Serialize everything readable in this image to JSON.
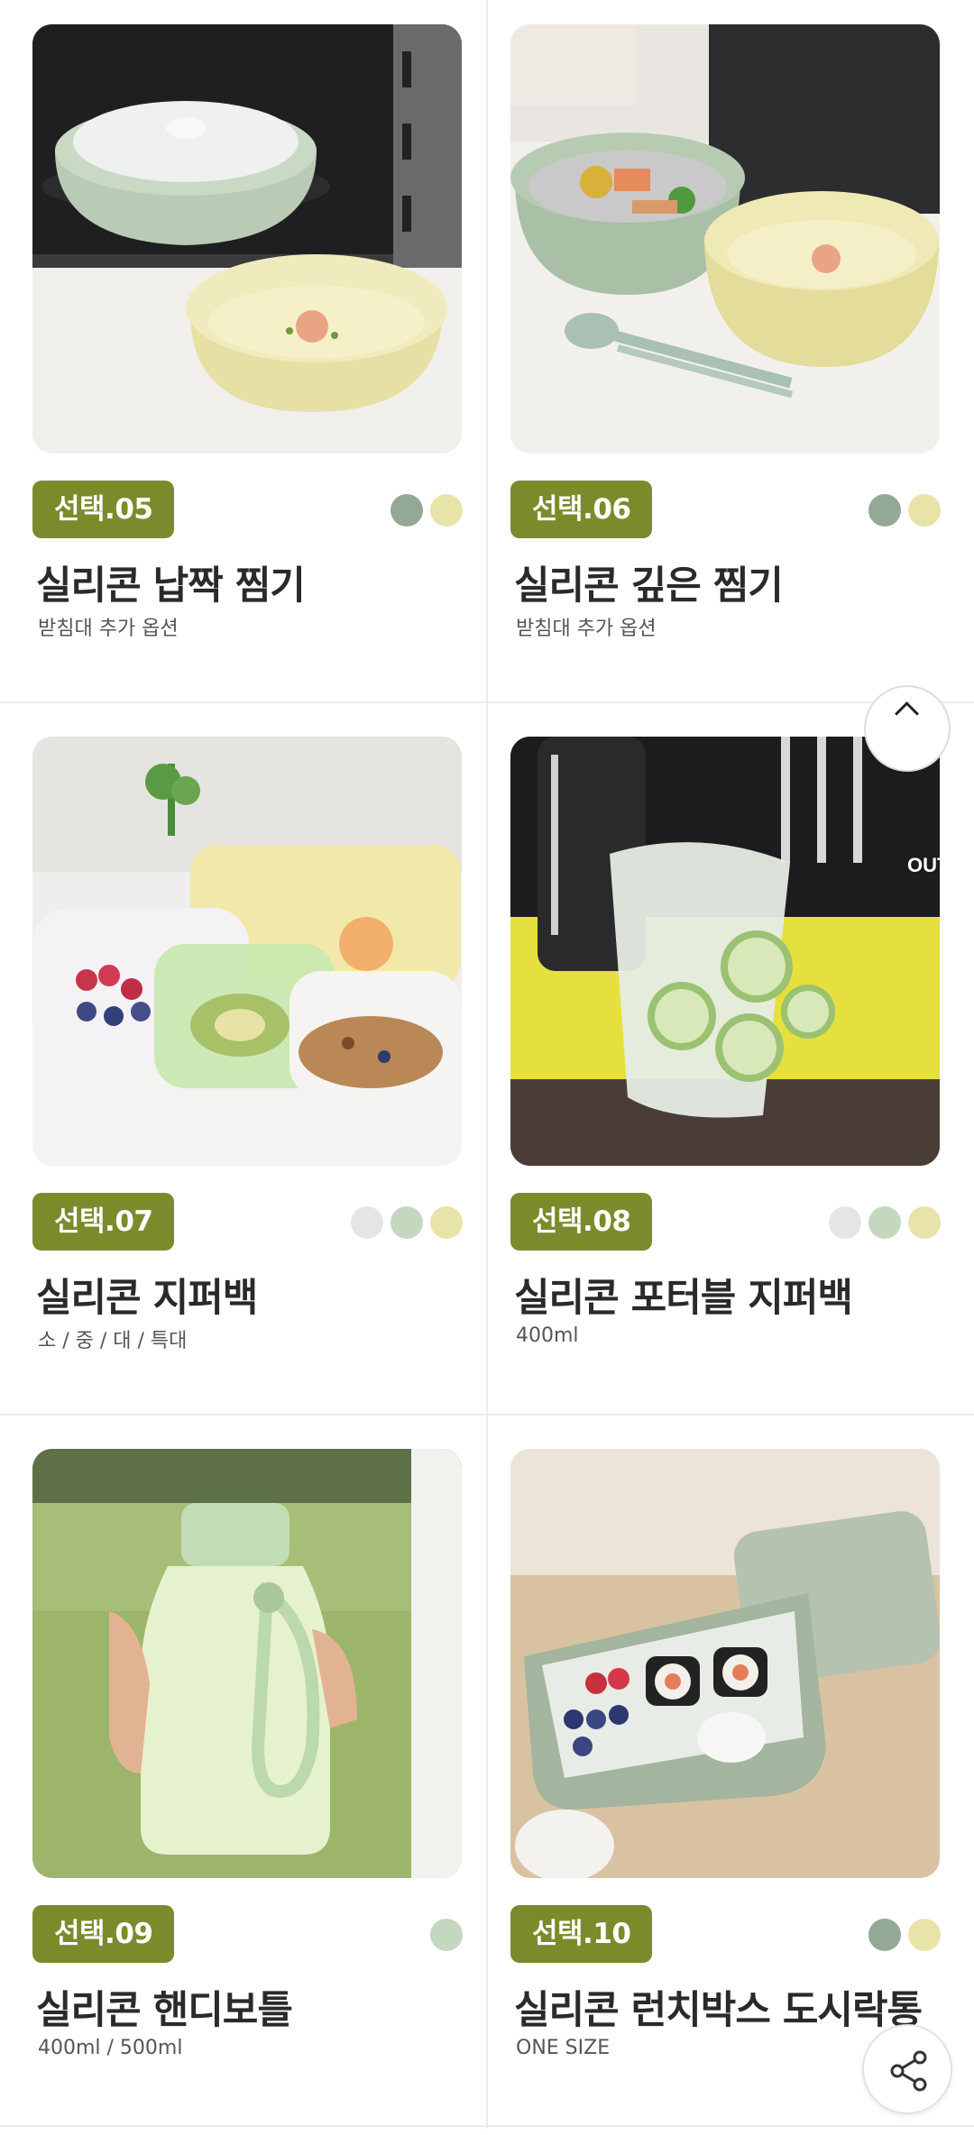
{
  "products": [
    {
      "tag": "선택.05",
      "title": "실리콘 납짝 찜기",
      "sub": "받침대 추가 옵션",
      "swatches": [
        "#94a896",
        "#e8e3a8"
      ],
      "image": "microwave-steamer-photo"
    },
    {
      "tag": "선택.06",
      "title": "실리콘 깊은 찜기",
      "sub": "받침대 추가 옵션",
      "swatches": [
        "#94a896",
        "#e8e3a8"
      ],
      "image": "deep-steamer-photo"
    },
    {
      "tag": "선택.07",
      "title": "실리콘 지퍼백",
      "sub": "소 / 중 / 대 / 특대",
      "swatches": [
        "#e5e5e5",
        "#c3d8bf",
        "#e8e3a8"
      ],
      "image": "zipper-bags-photo"
    },
    {
      "tag": "선택.08",
      "title": "실리콘 포터블 지퍼백",
      "sub": "400ml",
      "swatches": [
        "#e5e5e5",
        "#c3d8bf",
        "#e8e3a8"
      ],
      "image": "portable-zipper-bag-photo"
    },
    {
      "tag": "선택.09",
      "title": "실리콘 핸디보틀",
      "sub": "400ml / 500ml",
      "swatches": [
        "#c3d8bf"
      ],
      "image": "handy-bottle-photo"
    },
    {
      "tag": "선택.10",
      "title": "실리콘 런치박스 도시락통",
      "sub": "ONE SIZE",
      "swatches": [
        "#94a896",
        "#e8e3a8"
      ],
      "image": "lunchbox-photo"
    }
  ],
  "brand_badge_text": "OUT",
  "colors": {
    "tag_bg": "#7b8b2c",
    "divider": "#ececec"
  },
  "floating": {
    "scroll_top_icon": "chevron-up-icon",
    "share_icon": "share-icon"
  }
}
